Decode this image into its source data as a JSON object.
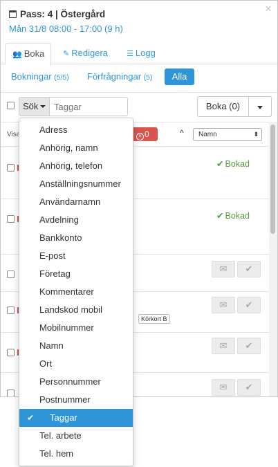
{
  "header": {
    "title": "Pass: 4 | Östergård",
    "subtitle": "Mån 31/8 08:00 - 17:00 (9 h)",
    "close": "×"
  },
  "tabs": [
    {
      "label": "Boka",
      "icon": "users-icon",
      "active": true
    },
    {
      "label": "Redigera",
      "icon": "edit-icon",
      "active": false
    },
    {
      "label": "Logg",
      "icon": "list-icon",
      "active": false
    }
  ],
  "filters": {
    "bookings_label": "Bokningar",
    "bookings_count": "(5/5)",
    "requests_label": "Förfrågningar",
    "requests_count": "(5)",
    "all_label": "Alla"
  },
  "toolbar": {
    "search_label": "Sök",
    "tag_placeholder": "Taggar",
    "boka_label": "Boka (0)"
  },
  "table_head": {
    "visa_label": "Visa",
    "red_count": "0",
    "sort_value": "Namn"
  },
  "rows": [
    {
      "status": "Bokad"
    },
    {
      "status": "Bokad"
    },
    {
      "status": ""
    },
    {
      "status": "",
      "tag": "Körkort B"
    },
    {
      "status": ""
    },
    {
      "status": ""
    }
  ],
  "search_dropdown": {
    "items": [
      "Adress",
      "Anhörig, namn",
      "Anhörig, telefon",
      "Anställningsnummer",
      "Användarnamn",
      "Avdelning",
      "Bankkonto",
      "E-post",
      "Företag",
      "Kommentarer",
      "Landskod mobil",
      "Mobilnummer",
      "Namn",
      "Ort",
      "Personnummer",
      "Postnummer",
      "Taggar",
      "Tel. arbete",
      "Tel. hem"
    ],
    "selected": "Taggar"
  },
  "colors": {
    "accent": "#2e96d8",
    "booked_green": "#5a9a3a",
    "danger_red": "#d9534f"
  }
}
